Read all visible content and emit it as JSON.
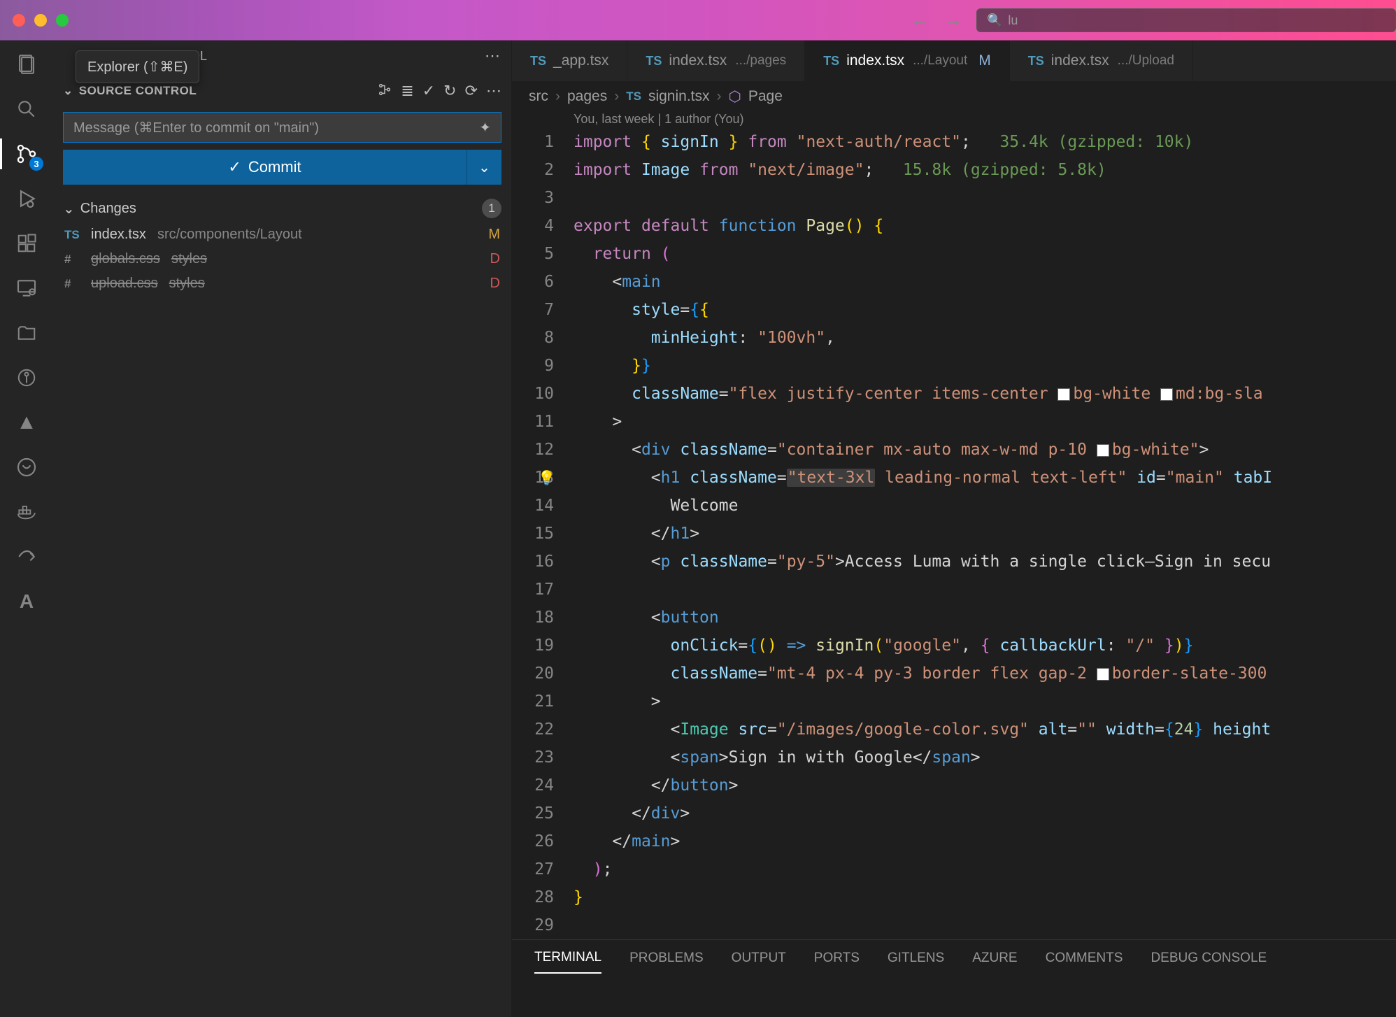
{
  "tooltip": "Explorer (⇧⌘E)",
  "titlebar": {
    "search_placeholder": "lu"
  },
  "activity": {
    "scm_badge": "3"
  },
  "sidebar": {
    "title_suffix": "OL",
    "section_title": "SOURCE CONTROL",
    "message_placeholder": "Message (⌘Enter to commit on \"main\")",
    "commit_label": "Commit",
    "changes_label": "Changes",
    "changes_count": "1",
    "changes": [
      {
        "icon": "TS",
        "name": "index.tsx",
        "path": "src/components/Layout",
        "status": "M",
        "deleted": false
      },
      {
        "icon": "#",
        "name": "globals.css",
        "path": "styles",
        "status": "D",
        "deleted": true
      },
      {
        "icon": "#",
        "name": "upload.css",
        "path": "styles",
        "status": "D",
        "deleted": true
      }
    ]
  },
  "tabs": [
    {
      "icon": "TS",
      "name": "_app.tsx",
      "sub": "",
      "mod": "",
      "active": false
    },
    {
      "icon": "TS",
      "name": "index.tsx",
      "sub": ".../pages",
      "mod": "",
      "active": false
    },
    {
      "icon": "TS",
      "name": "index.tsx",
      "sub": ".../Layout",
      "mod": "M",
      "active": true
    },
    {
      "icon": "TS",
      "name": "index.tsx",
      "sub": ".../Upload",
      "mod": "",
      "active": false
    }
  ],
  "breadcrumb": {
    "parts": [
      "src",
      "pages",
      "signin.tsx",
      "Page"
    ]
  },
  "codelens": "You, last week | 1 author (You)",
  "gzip": {
    "line1": "35.4k (gzipped: 10k)",
    "line2": "15.8k (gzipped: 5.8k)"
  },
  "code": {
    "import1_module": "\"next-auth/react\"",
    "import1_name": "signIn",
    "import2_module": "\"next/image\"",
    "import2_name": "Image",
    "fn_name": "Page",
    "minHeight": "\"100vh\"",
    "mainClass": "\"flex justify-center items-center ",
    "mainClass2": "bg-white ",
    "mainClass3": "md:bg-sla",
    "divClass": "\"container mx-auto max-w-md p-10 ",
    "divClass2": "bg-white\"",
    "h1Class_hl": "\"text-3xl",
    "h1Class_rest": " leading-normal text-left\"",
    "h1Id": "\"main\"",
    "h1Text": "Welcome",
    "pClass": "\"py-5\"",
    "pText": "Access Luma with a single click—Sign in secu",
    "signInProvider": "\"google\"",
    "callbackKey": "callbackUrl",
    "callbackVal": "\"/\"",
    "btnClass": "\"mt-4 px-4 py-3 border flex gap-2 ",
    "btnClass2": "border-slate-300",
    "imgSrc": "\"/images/google-color.svg\"",
    "imgAlt": "\"\"",
    "imgWidth": "24",
    "spanText": "Sign in with Google"
  },
  "panel_tabs": [
    "TERMINAL",
    "PROBLEMS",
    "OUTPUT",
    "PORTS",
    "GITLENS",
    "AZURE",
    "COMMENTS",
    "DEBUG CONSOLE"
  ]
}
